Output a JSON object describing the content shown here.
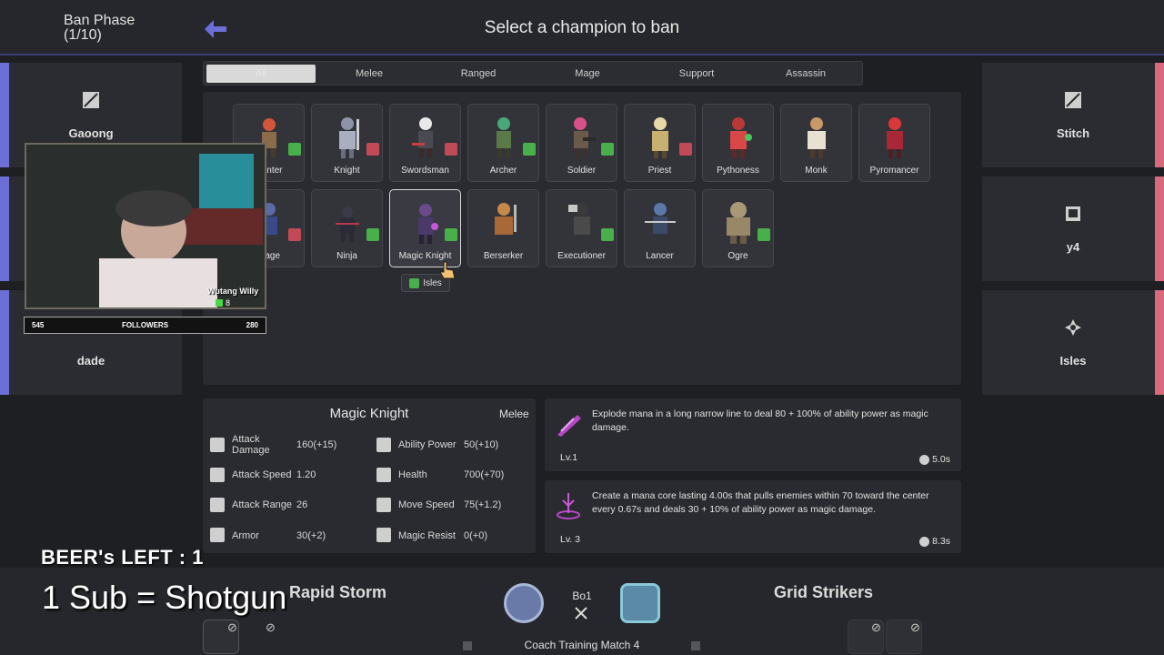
{
  "header": {
    "phase_line1": "Ban Phase",
    "phase_line2": "(1/10)",
    "title": "Select a champion to ban"
  },
  "left_slots": [
    {
      "name": "Gaoong"
    },
    {
      "name": ""
    },
    {
      "name": "dade"
    }
  ],
  "right_slots": [
    {
      "name": "Stitch"
    },
    {
      "name": "y4"
    },
    {
      "name": "Isles"
    }
  ],
  "filters": [
    "All",
    "Melee",
    "Ranged",
    "Mage",
    "Support",
    "Assassin"
  ],
  "active_filter": "All",
  "champions_row1": [
    "Hunter",
    "Knight",
    "Swordsman",
    "Archer",
    "Soldier",
    "Priest",
    "Pythoness",
    "Monk",
    "Pyromancer"
  ],
  "champions_row2": [
    "Mage",
    "Ninja",
    "Magic Knight",
    "Berserker",
    "Executioner",
    "Lancer",
    "Ogre"
  ],
  "hover_tag": "Isles",
  "selected": {
    "name": "Magic Knight",
    "role": "Melee",
    "stats": [
      {
        "label": "Attack Damage",
        "value": "160(+15)",
        "icon": "sword-icon"
      },
      {
        "label": "Ability Power",
        "value": "50(+10)",
        "icon": "wand-icon"
      },
      {
        "label": "Attack Speed",
        "value": "1.20",
        "icon": "swords-icon"
      },
      {
        "label": "Health",
        "value": "700(+70)",
        "icon": "plus-icon"
      },
      {
        "label": "Attack Range",
        "value": "26",
        "icon": "range-icon"
      },
      {
        "label": "Move Speed",
        "value": "75(+1.2)",
        "icon": "boot-icon"
      },
      {
        "label": "Armor",
        "value": "30(+2)",
        "icon": "shield-icon"
      },
      {
        "label": "Magic Resist",
        "value": "0(+0)",
        "icon": "magic-shield-icon"
      }
    ]
  },
  "abilities": [
    {
      "text": "Explode mana in a long narrow line to deal 80 + 100% of ability power as magic damage.",
      "level": "Lv.1",
      "cooldown": "5.0s"
    },
    {
      "text": "Create a mana core lasting 4.00s that pulls enemies within 70 toward the center every 0.67s and deals 30 + 10% of ability power as magic damage.",
      "level": "Lv. 3",
      "cooldown": "8.3s"
    }
  ],
  "match": {
    "team_left": "Rapid Storm",
    "team_right": "Grid Strikers",
    "format": "Bo1",
    "name": "Coach Training Match 4"
  },
  "stream": {
    "beers": "BEER's LEFT : 1",
    "sub_text": "1 Sub = Shotgun",
    "cam_name": "Wutang Willy",
    "cam_count": "8",
    "followers_left": "545",
    "followers_label": "FOLLOWERS",
    "followers_right": "280"
  },
  "colors": {
    "blue_team": "#6b6fd6",
    "red_team": "#d86a7c",
    "like": "#48b04a",
    "dislike": "#c24a56"
  }
}
